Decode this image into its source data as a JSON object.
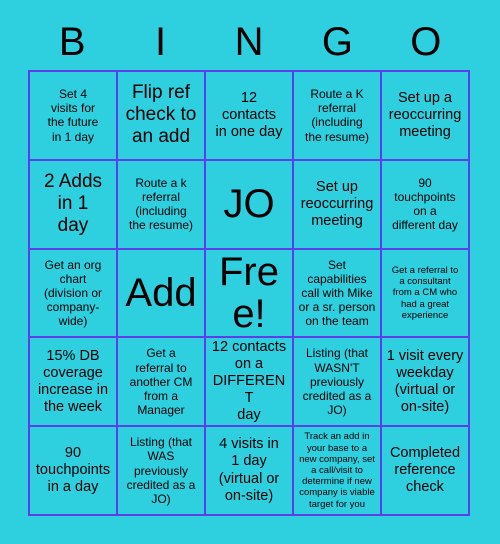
{
  "card": {
    "title": "BINGO",
    "colors": {
      "background": "#2ecfdf",
      "grid_line": "#5b3fe8",
      "text": "#000000"
    },
    "header_letters": [
      "B",
      "I",
      "N",
      "G",
      "O"
    ],
    "columns": 5,
    "rows": 5,
    "cells": [
      {
        "text": "Set 4\nvisits for\nthe future\nin 1 day",
        "size": "s"
      },
      {
        "text": "Flip ref\ncheck to\nan add",
        "size": "l"
      },
      {
        "text": "12\ncontacts\nin one day",
        "size": "m"
      },
      {
        "text": "Route a K\nreferral\n(including\nthe resume)",
        "size": "s"
      },
      {
        "text": "Set up a\nreoccurring\nmeeting",
        "size": "m"
      },
      {
        "text": "2 Adds\nin 1\nday",
        "size": "l"
      },
      {
        "text": "Route a k\nreferral\n(including\nthe resume)",
        "size": "s"
      },
      {
        "text": "JO",
        "size": "xxl"
      },
      {
        "text": "Set up\nreoccurring\nmeeting",
        "size": "m"
      },
      {
        "text": "90\ntouchpoints\non a\ndifferent day",
        "size": "s"
      },
      {
        "text": "Get an org\nchart\n(division or\ncompany-\nwide)",
        "size": "s"
      },
      {
        "text": "Add",
        "size": "xxl"
      },
      {
        "text": "Free!",
        "size": "xxl"
      },
      {
        "text": "Set\ncapabilities\ncall with Mike\nor a sr. person\non the team",
        "size": "s"
      },
      {
        "text": "Get a referral to\na consultant\nfrom a CM who\nhad a great\nexperience",
        "size": "xs"
      },
      {
        "text": "15% DB\ncoverage\nincrease in\nthe week",
        "size": "m"
      },
      {
        "text": "Get a\nreferral to\nanother CM\nfrom a\nManager",
        "size": "s"
      },
      {
        "text": "12 contacts\non a\nDIFFERENT\nday",
        "size": "m"
      },
      {
        "text": "Listing (that\nWASN'T\npreviously\ncredited as a\nJO)",
        "size": "s"
      },
      {
        "text": "1 visit every\nweekday\n(virtual or\non-site)",
        "size": "m"
      },
      {
        "text": "90\ntouchpoints\nin a day",
        "size": "m"
      },
      {
        "text": "Listing (that\nWAS\npreviously\ncredited as a\nJO)",
        "size": "s"
      },
      {
        "text": "4 visits in\n1 day\n(virtual or\non-site)",
        "size": "m"
      },
      {
        "text": "Track an add in\nyour base to a\nnew company, set\na call/visit to\ndetermine if new\ncompany is viable\ntarget for you",
        "size": "xs"
      },
      {
        "text": "Completed\nreference\ncheck",
        "size": "m"
      }
    ]
  }
}
